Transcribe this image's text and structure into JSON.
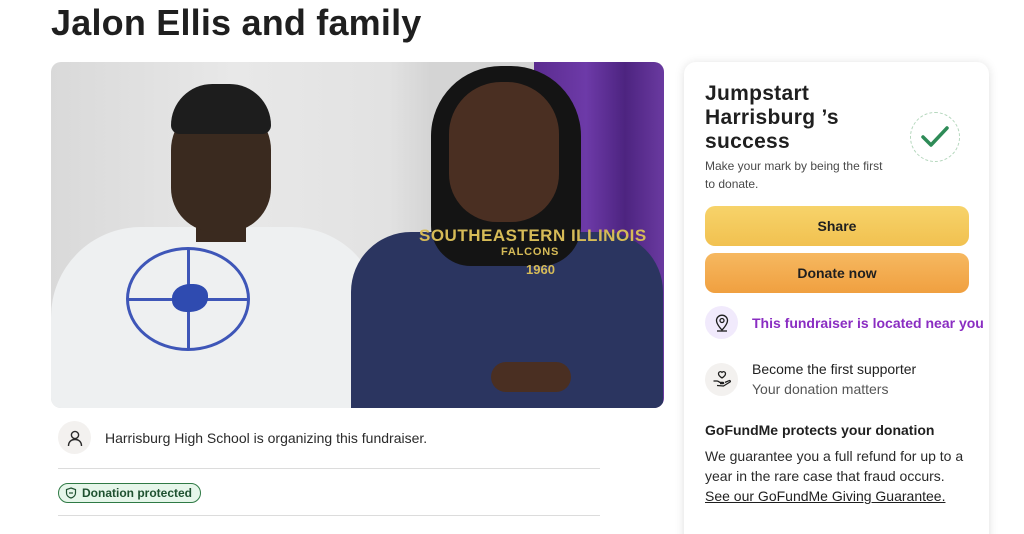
{
  "page": {
    "title": "Jalon Ellis and family"
  },
  "photo": {
    "shirt_line1": "SOUTHEASTERN ILLINOIS",
    "shirt_line2": "FALCONS",
    "shirt_line3": "1960"
  },
  "organizer": {
    "icon": "user-icon",
    "text": "Harrisburg High School is organizing this fundraiser."
  },
  "badge": {
    "icon": "shield-icon",
    "label": "Donation protected"
  },
  "card": {
    "title": "Jumpstart Harrisburg ’s success",
    "subtitle": "Make your mark by being the first to donate.",
    "check_icon": "checkmark-icon",
    "share_label": "Share",
    "donate_label": "Donate now",
    "location": {
      "icon": "location-pin-icon",
      "text": "This fundraiser is located near you"
    },
    "supporter": {
      "icon": "hand-heart-icon",
      "line1": "Become the first supporter",
      "line2": "Your donation matters"
    },
    "protect": {
      "title": "GoFundMe protects your donation",
      "body": "We guarantee you a full refund for up to a year in the rare case that fraud occurs. ",
      "link": "See our GoFundMe Giving Guarantee."
    }
  },
  "colors": {
    "share_button": "#f1c150",
    "donate_button": "#f0a040",
    "location_text": "#8a2dc2",
    "check_green": "#2e8b57",
    "badge_bg": "#e6f6ea"
  }
}
